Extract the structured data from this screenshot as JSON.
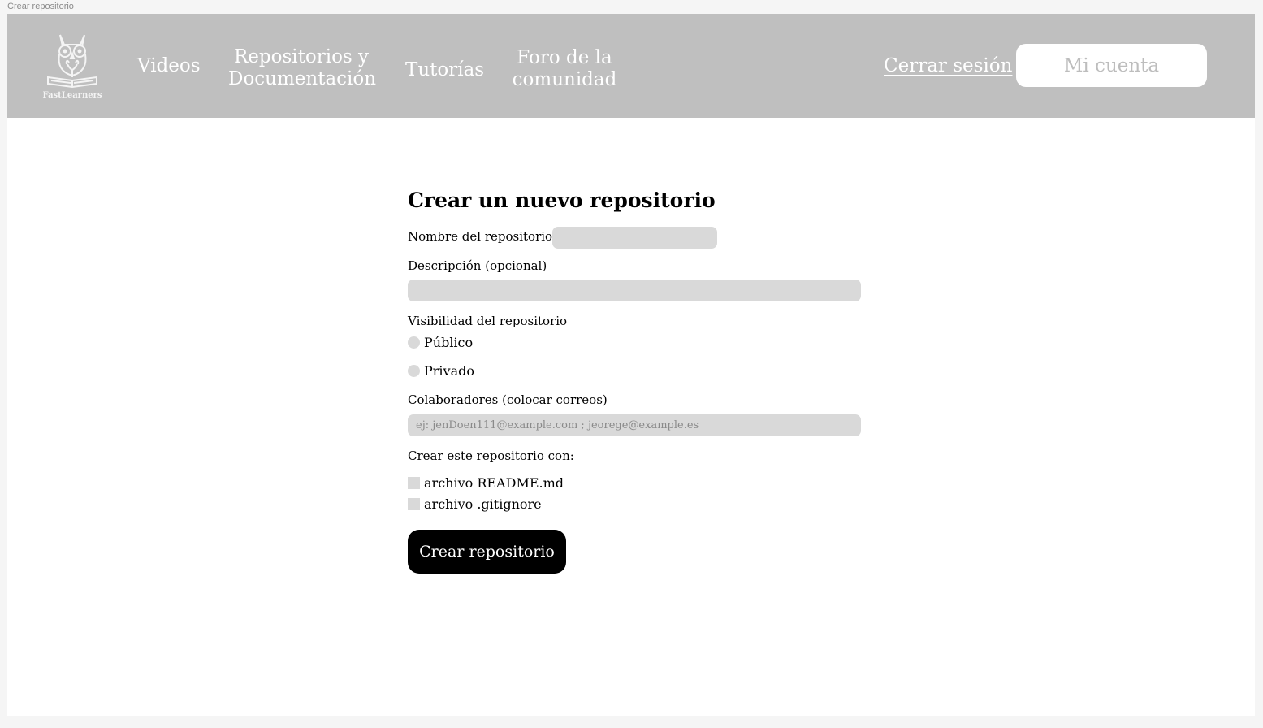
{
  "frame": {
    "label": "Crear repositorio"
  },
  "nav": {
    "logo_text": "FastLearners",
    "videos": "Videos",
    "repos_line1": "Repositorios y",
    "repos_line2": "Documentación",
    "tutorias": "Tutorías",
    "foro_line1": "Foro de la",
    "foro_line2": "comunidad",
    "logout": "Cerrar sesión",
    "account": "Mi cuenta"
  },
  "form": {
    "title": "Crear un nuevo repositorio",
    "name_label": "Nombre del repositorio",
    "name_value": "",
    "description_label": "Descripción (opcional)",
    "description_value": "",
    "visibility_label": "Visibilidad del repositorio",
    "visibility_options": [
      "Público",
      "Privado"
    ],
    "collaborators_label": "Colaboradores (colocar correos)",
    "collaborators_placeholder": "ej: jenDoen111@example.com ; jeorege@example.es",
    "create_with_label": "Crear este repositorio con:",
    "checkbox_options": [
      "archivo README.md",
      "archivo .gitignore"
    ],
    "submit": "Crear repositorio"
  },
  "colors": {
    "navbar": "#bfbfbf",
    "field": "#d9d9d9",
    "button": "#000000",
    "account_text": "#bdbdbd"
  }
}
